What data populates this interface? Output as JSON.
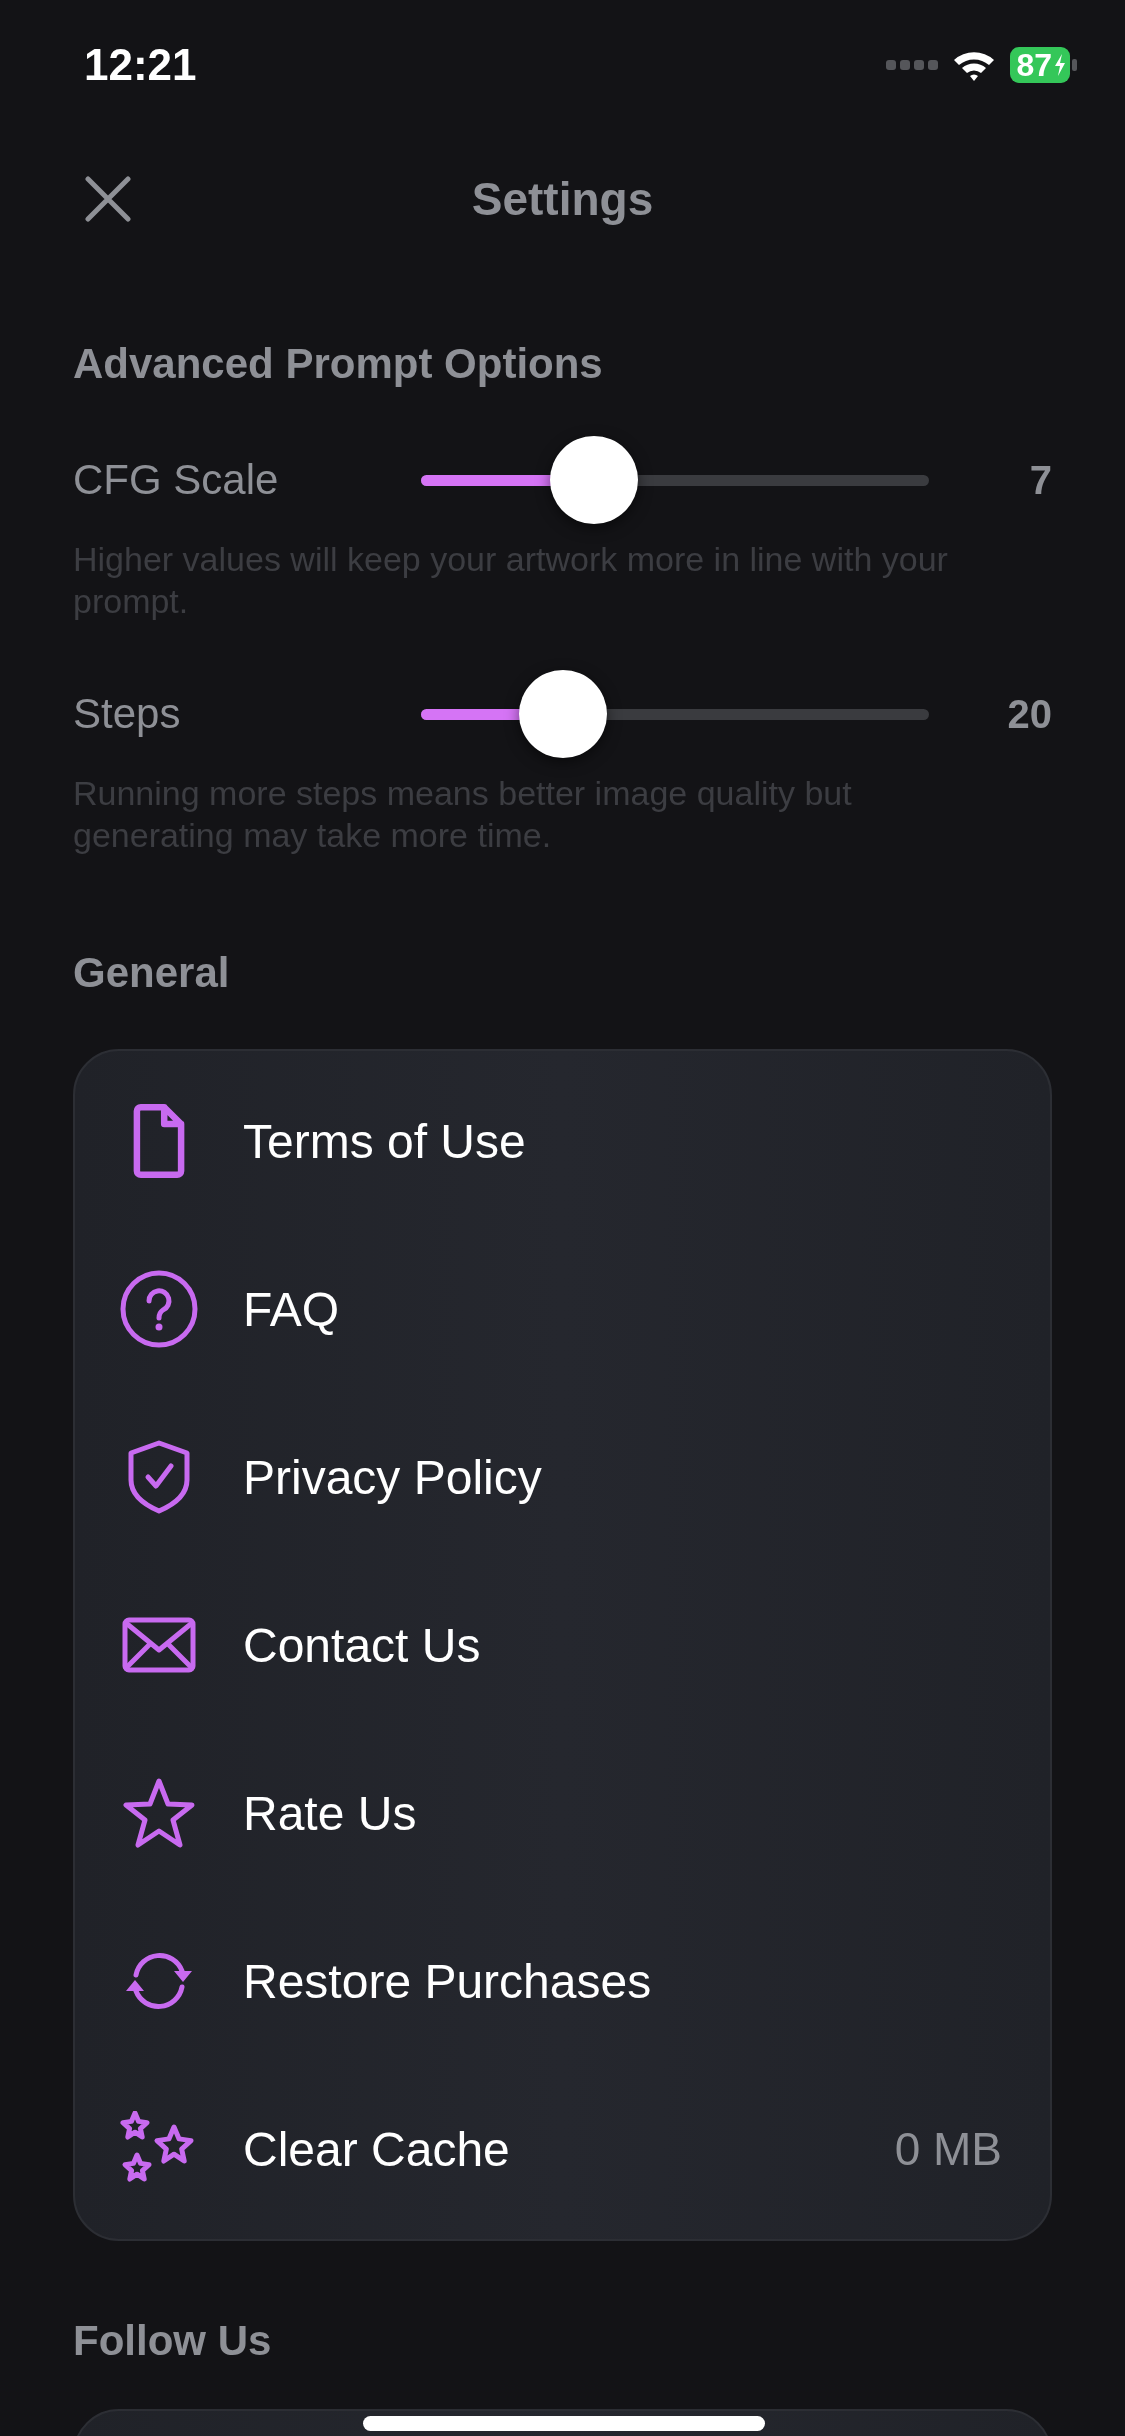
{
  "status_bar": {
    "time": "12:21",
    "battery": "87"
  },
  "header": {
    "title": "Settings"
  },
  "advanced": {
    "title": "Advanced Prompt Options",
    "sliders": [
      {
        "label": "CFG Scale",
        "value": "7",
        "level": 0.34,
        "description": "Higher values will keep your artwork more in line with your prompt."
      },
      {
        "label": "Steps",
        "value": "20",
        "level": 0.28,
        "description": "Running more steps means better image quality but generating may take more time."
      }
    ]
  },
  "general": {
    "title": "General",
    "items": [
      {
        "kind": "document",
        "label": "Terms of Use"
      },
      {
        "kind": "question",
        "label": "FAQ"
      },
      {
        "kind": "shield",
        "label": "Privacy Policy"
      },
      {
        "kind": "envelope",
        "label": "Contact Us"
      },
      {
        "kind": "star",
        "label": "Rate Us"
      },
      {
        "kind": "refresh",
        "label": "Restore Purchases"
      },
      {
        "kind": "stars",
        "label": "Clear Cache",
        "detail": "0 MB"
      }
    ]
  },
  "follow": {
    "title": "Follow Us"
  }
}
